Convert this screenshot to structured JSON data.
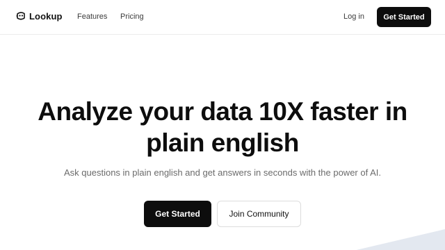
{
  "brand": {
    "name": "Lookup",
    "icon": "lookup-logo-icon"
  },
  "nav": {
    "links": [
      {
        "label": "Features"
      },
      {
        "label": "Pricing"
      }
    ],
    "login_label": "Log in",
    "cta_label": "Get Started"
  },
  "hero": {
    "title_line1": "Analyze your data 10X faster in",
    "title_line2": "plain english",
    "subtitle": "Ask questions in plain english and get answers in seconds with the power of AI.",
    "primary_button": "Get Started",
    "secondary_button": "Join Community"
  },
  "colors": {
    "primary": "#0d0d0d",
    "text_muted": "#6b6b6b",
    "border": "#dcdcdc",
    "decoration": "#e3e8f0"
  }
}
